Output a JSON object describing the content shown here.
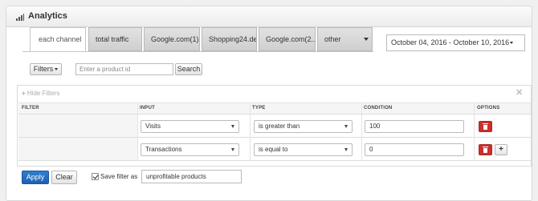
{
  "header": {
    "title": "Analytics",
    "icon": "bar-chart-icon"
  },
  "tabs": [
    {
      "label": "each channel",
      "active": true
    },
    {
      "label": "total traffic"
    },
    {
      "label": "Google.com(1)"
    },
    {
      "label": "Shopping24.de"
    },
    {
      "label": "Google.com(2..."
    },
    {
      "label": "other",
      "dropdown": true
    }
  ],
  "date_range": "October 04, 2016 - October 10, 2016",
  "toolbar": {
    "filters_label": "Filters",
    "product_placeholder": "Enter a product id",
    "search_label": "Search"
  },
  "filter_panel": {
    "hide_label": "Hide Filters",
    "columns": [
      "FILTER",
      "INPUT",
      "TYPE",
      "CONDITION",
      "OPTIONS"
    ],
    "rows": [
      {
        "input": "Visits",
        "type": "is greater than",
        "condition": "100"
      },
      {
        "input": "Transactions",
        "type": "is equal to",
        "condition": "0"
      }
    ]
  },
  "footer": {
    "apply_label": "Apply",
    "clear_label": "Clear",
    "save_label": "Save filter as",
    "save_checked": true,
    "save_value": "unprofitable products"
  },
  "colors": {
    "primary": "#1f5fb0",
    "danger": "#c9302c"
  }
}
